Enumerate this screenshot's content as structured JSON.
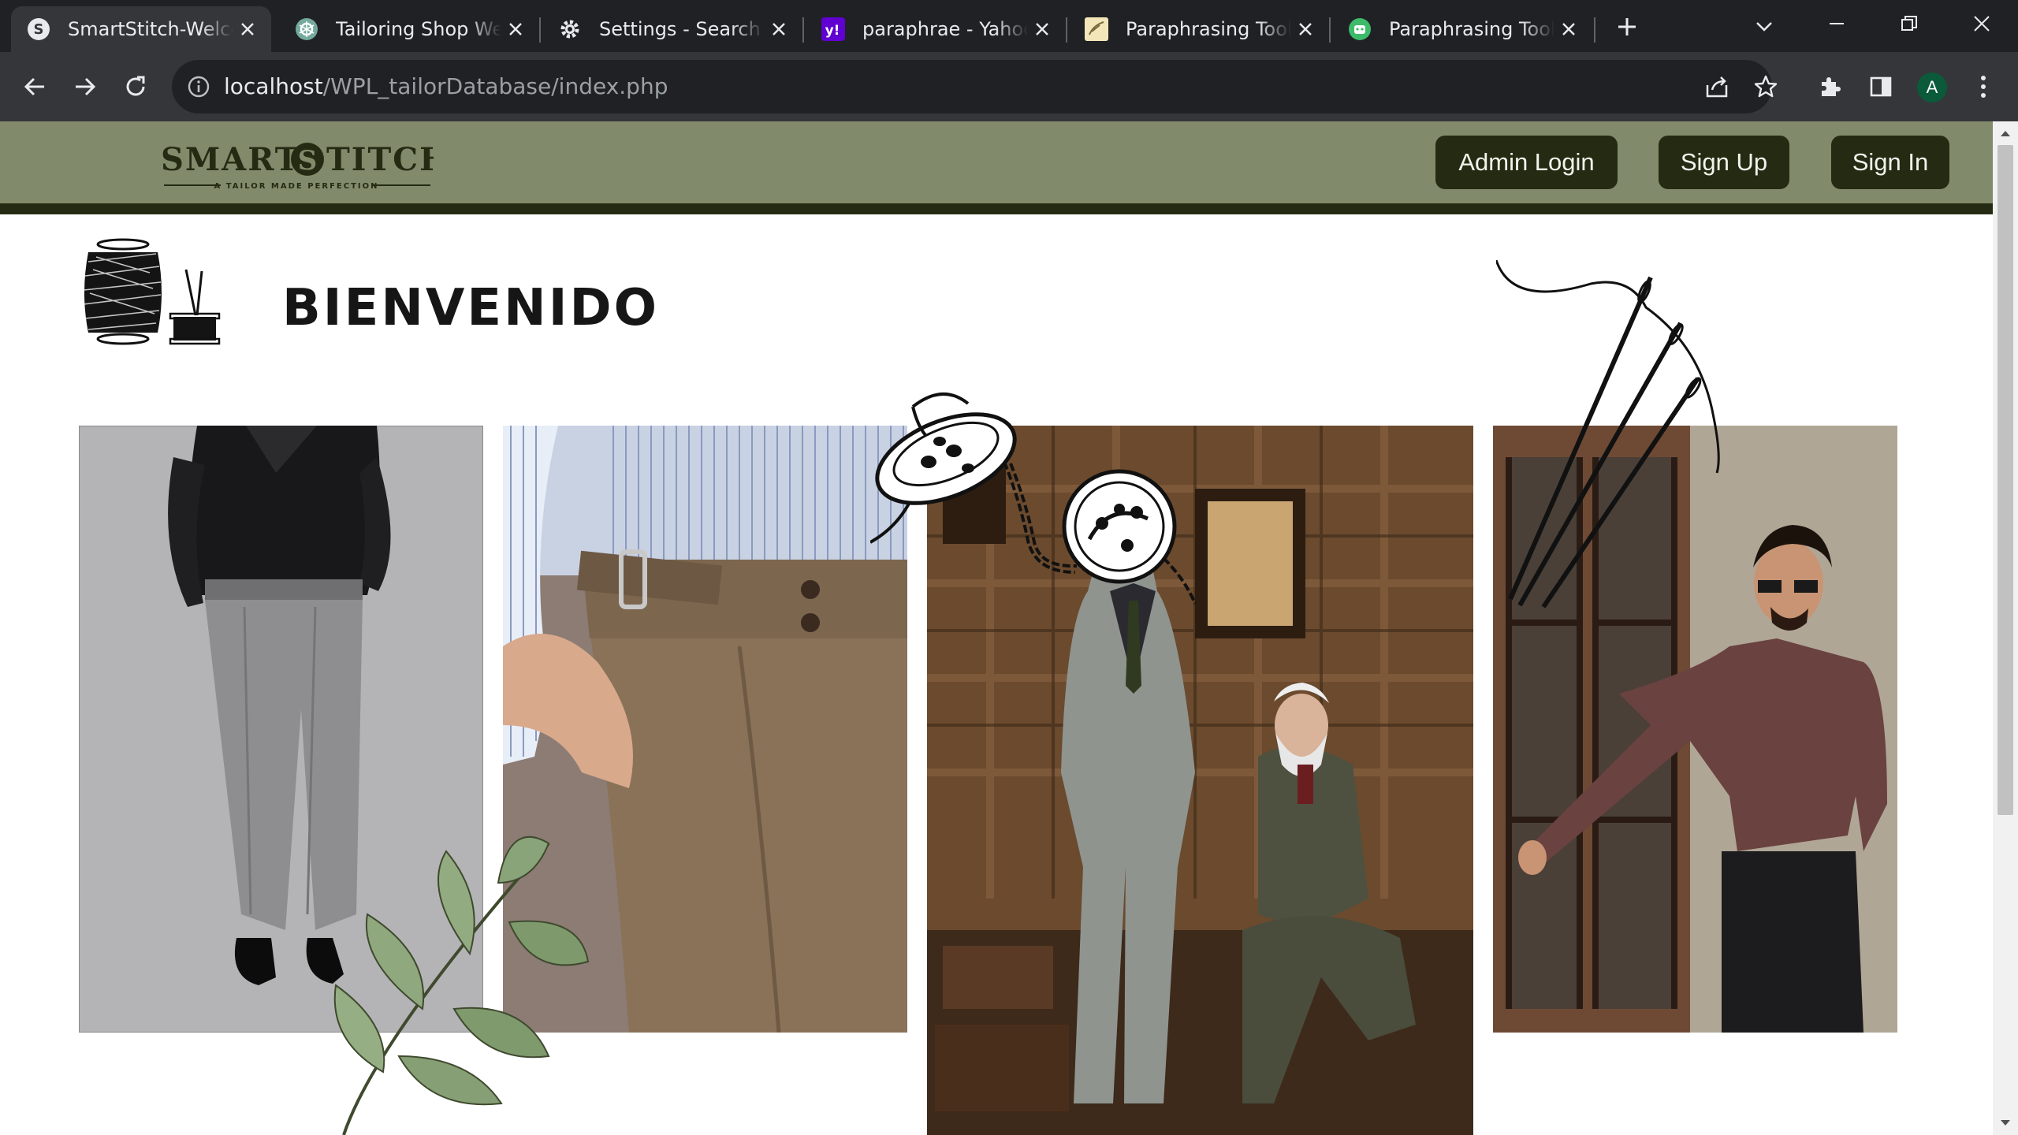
{
  "browser": {
    "tabs": [
      {
        "title": "SmartStitch-Welco",
        "icon": "smartstitch-favicon"
      },
      {
        "title": "Tailoring Shop We",
        "icon": "chatgpt-favicon"
      },
      {
        "title": "Settings - Search e",
        "icon": "gear-icon"
      },
      {
        "title": "paraphrae - Yahoo",
        "icon": "yahoo-favicon"
      },
      {
        "title": "Paraphrasing Tool",
        "icon": "quillbot-favicon"
      },
      {
        "title": "Paraphrasing Tool",
        "icon": "android-favicon"
      }
    ],
    "url_host": "localhost",
    "url_path": "/WPL_tailorDatabase/index.php",
    "profile_initial": "A"
  },
  "site": {
    "logo_text": "SMART",
    "logo_text2": "TITCH",
    "logo_letter": "S",
    "logo_tagline": "A TAILOR MADE PERFECTION",
    "nav": {
      "admin_login": "Admin Login",
      "sign_up": "Sign Up",
      "sign_in": "Sign In"
    },
    "hero_title": "BIENVENIDO"
  },
  "colors": {
    "header_bg": "#818b6b",
    "header_border": "#252b13",
    "button_bg": "#252b13",
    "button_text": "#f2f3ec"
  }
}
